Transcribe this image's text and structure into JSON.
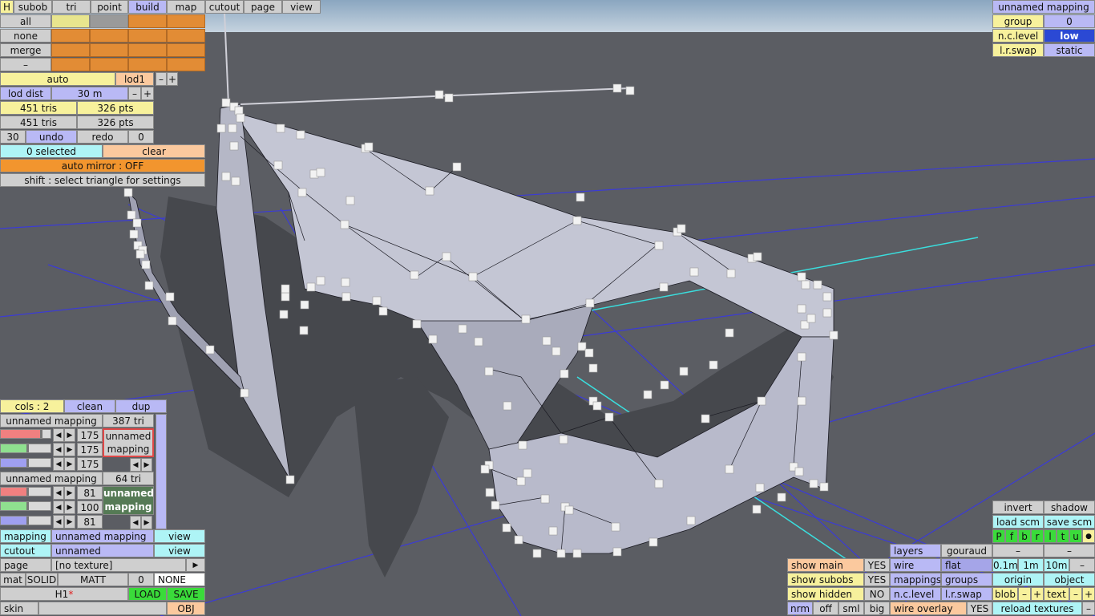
{
  "colors": {
    "sky": "#9bb3c9",
    "ground": "#5a5c62",
    "grid": "#3a3ad8",
    "axis": "#3adede",
    "mesh": "#c4c6d4"
  },
  "top": {
    "h_label": "H",
    "tabs": [
      {
        "label": "subob"
      },
      {
        "label": "tri"
      },
      {
        "label": "point"
      },
      {
        "label": "build"
      },
      {
        "label": "map"
      },
      {
        "label": "cutout"
      },
      {
        "label": "page"
      },
      {
        "label": "view"
      }
    ],
    "active_tab": "build"
  },
  "select": {
    "all": "all",
    "none": "none",
    "merge": "merge",
    "dash": "–"
  },
  "lod": {
    "auto": "auto",
    "lod1": "lod1",
    "minus": "–",
    "plus": "+",
    "dist_label": "lod dist",
    "dist_value": "30 m",
    "tris1": "451 tris",
    "pts1": "326 pts",
    "tris2": "451 tris",
    "pts2": "326 pts",
    "num30": "30",
    "undo": "undo",
    "redo": "redo",
    "num0": "0"
  },
  "selection": {
    "selected": "0 selected",
    "clear": "clear",
    "auto_mirror": "auto mirror : OFF",
    "hint": "shift : select triangle for settings"
  },
  "mappings": {
    "cols": "cols : 2",
    "clean": "clean",
    "dup": "dup",
    "m1": {
      "name": "unnamed mapping",
      "tri": "387 tri",
      "v1": "175",
      "v2": "175",
      "v3": "175",
      "swatch": "unnamed mapping",
      "r": 0.82,
      "g": 0.55,
      "b": 0.55
    },
    "m2": {
      "name": "unnamed mapping",
      "tri": "64 tri",
      "v1": "81",
      "v2": "100",
      "v3": "81",
      "swatch": "unnamed mapping",
      "r": 0.55,
      "g": 0.55,
      "b": 0.55
    }
  },
  "props": {
    "mapping_label": "mapping",
    "mapping_value": "unnamed mapping",
    "view1": "view",
    "cutout_label": "cutout",
    "cutout_value": "unnamed",
    "view2": "view",
    "page_label": "page",
    "page_value": "[no texture]",
    "page_arrow": "▶",
    "mat": "mat",
    "solid": "SOLID",
    "matt": "MATT",
    "mat_num": "0",
    "none": "NONE",
    "name": "H1",
    "star": "*",
    "load": "LOAD",
    "save": "SAVE",
    "skin": "skin",
    "obj": "OBJ"
  },
  "topright": {
    "title": "unnamed mapping",
    "group": "group",
    "group_val": "0",
    "nc_level": "n.c.level",
    "nc_val": "low",
    "lr_swap": "l.r.swap",
    "lr_val": "static"
  },
  "bottomright": {
    "show_main": "show main",
    "show_main_val": "YES",
    "show_subobs": "show subobs",
    "show_subobs_val": "YES",
    "show_hidden": "show hidden",
    "show_hidden_val": "NO",
    "nrm": "nrm",
    "off": "off",
    "sml": "sml",
    "big": "big",
    "layers": "layers",
    "gouraud": "gouraud",
    "wire": "wire",
    "flat": "flat",
    "mappings": "mappings",
    "groups": "groups",
    "nc_level": "n.c.level",
    "lr_swap": "l.r.swap",
    "wire_overlay": "wire overlay",
    "wire_overlay_val": "YES",
    "invert": "invert",
    "shadow": "shadow",
    "load_scm": "load scm",
    "save_scm": "save scm",
    "letters": [
      "P",
      "f",
      "b",
      "r",
      "l",
      "t",
      "u",
      "●"
    ],
    "dash1": "–",
    "dash2": "–",
    "d01": "0.1m",
    "d1": "1m",
    "d10": "10m",
    "dm": "–",
    "origin": "origin",
    "object": "object",
    "blob": "blob",
    "bm": "–",
    "bp": "+",
    "text": "text",
    "tm": "–",
    "tp": "+",
    "reload": "reload textures",
    "rm": "–"
  }
}
